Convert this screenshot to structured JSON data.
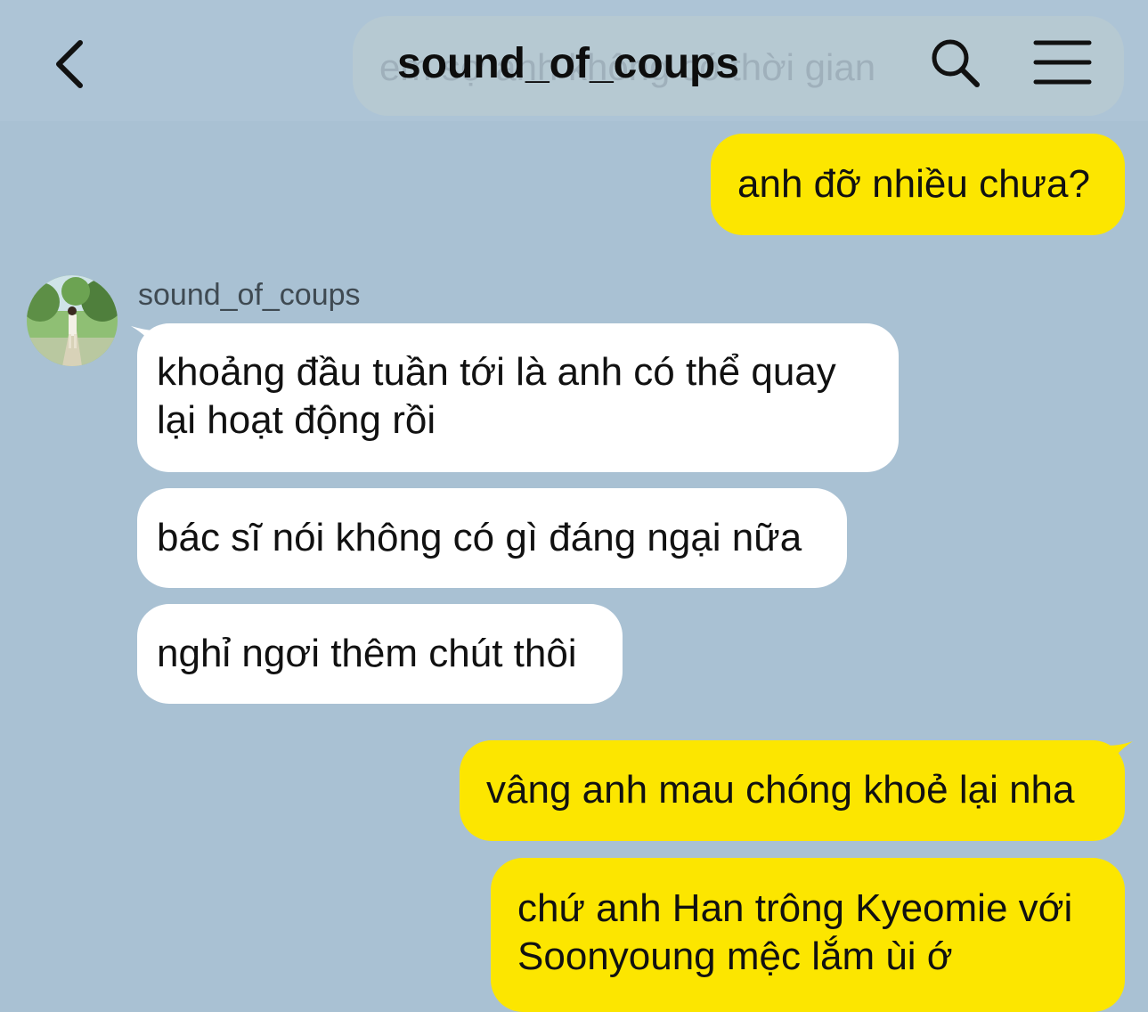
{
  "header": {
    "title": "sound_of_coups",
    "ghost_text": "em sợ anh không có thời gian"
  },
  "icons": {
    "back": "chevron-left-icon",
    "search": "search-icon",
    "menu": "hamburger-menu-icon"
  },
  "colors": {
    "background": "#a9c1d3",
    "my_bubble": "#fce600",
    "their_bubble": "#ffffff"
  },
  "contact": {
    "name": "sound_of_coups"
  },
  "messages": [
    {
      "from": "me",
      "text": "anh đỡ nhiều chưa?"
    },
    {
      "from": "sound_of_coups",
      "lines": [
        "khoảng đầu tuần tới là anh có thể quay",
        "lại hoạt động rồi"
      ]
    },
    {
      "from": "sound_of_coups",
      "text": "bác sĩ nói không có gì đáng ngại nữa"
    },
    {
      "from": "sound_of_coups",
      "text": "nghỉ ngơi thêm chút thôi"
    },
    {
      "from": "me",
      "text": "vâng anh mau chóng khoẻ lại nha"
    },
    {
      "from": "me",
      "lines": [
        "chứ anh Han trông Kyeomie với",
        "Soonyoung mệc lắm ùi ớ"
      ]
    }
  ]
}
